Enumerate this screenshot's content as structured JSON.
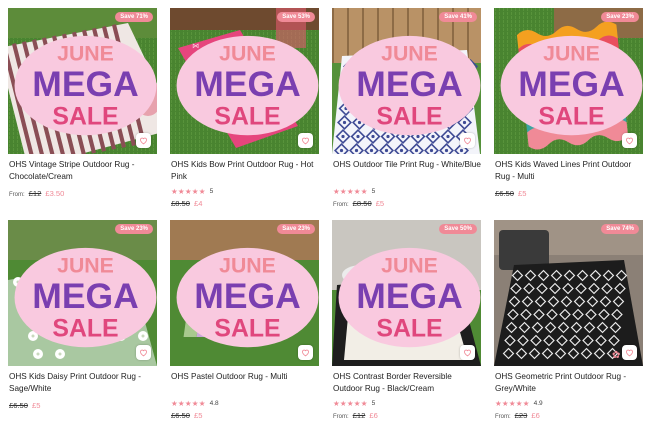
{
  "products": [
    {
      "title": "OHS Vintage Stripe Outdoor Rug - Chocolate/Cream",
      "badge": "Save 71%",
      "has_mega": true,
      "art": "stripe",
      "rating_stars": "",
      "rating_value": "",
      "from_label": "From:",
      "price_was": "£12",
      "price_now": "£3.50"
    },
    {
      "title": "OHS Kids Bow Print Outdoor Rug - Hot Pink",
      "badge": "Save 53%",
      "has_mega": true,
      "art": "bow",
      "rating_stars": "★★★★★",
      "rating_value": "5",
      "from_label": "",
      "price_was": "£8.50",
      "price_now": "£4"
    },
    {
      "title": "OHS Outdoor Tile Print Rug - White/Blue",
      "badge": "Save 41%",
      "has_mega": true,
      "art": "tile",
      "rating_stars": "★★★★★",
      "rating_value": "5",
      "from_label": "From:",
      "price_was": "£8.50",
      "price_now": "£5"
    },
    {
      "title": "OHS Kids Waved Lines Print Outdoor Rug - Multi",
      "badge": "Save 23%",
      "has_mega": true,
      "art": "wave",
      "rating_stars": "",
      "rating_value": "",
      "from_label": "",
      "price_was": "£6.50",
      "price_now": "£5"
    },
    {
      "title": "OHS Kids Daisy Print Outdoor Rug - Sage/White",
      "badge": "Save 23%",
      "has_mega": true,
      "art": "daisy",
      "rating_stars": "",
      "rating_value": "",
      "from_label": "",
      "price_was": "£6.50",
      "price_now": "£5"
    },
    {
      "title": "OHS Pastel Outdoor Rug - Multi",
      "badge": "Save 23%",
      "has_mega": true,
      "art": "pastel",
      "rating_stars": "★★★★★",
      "rating_value": "4.8",
      "from_label": "",
      "price_was": "£6.50",
      "price_now": "£5"
    },
    {
      "title": "OHS Contrast Border Reversible Outdoor Rug - Black/Cream",
      "badge": "Save 50%",
      "has_mega": true,
      "art": "border",
      "rating_stars": "★★★★★",
      "rating_value": "5",
      "from_label": "From:",
      "price_was": "£12",
      "price_now": "£6"
    },
    {
      "title": "OHS Geometric Print Outdoor Rug - Grey/White",
      "badge": "Save 74%",
      "has_mega": false,
      "art": "geo",
      "rating_stars": "★★★★★",
      "rating_value": "4.9",
      "from_label": "From:",
      "price_was": "£23",
      "price_now": "£6"
    }
  ],
  "promo_badge": {
    "line1": "JUNE",
    "line2": "MEGA",
    "line3": "SALE"
  },
  "colors": {
    "accent": "#f08a97",
    "grass": "#4f8a34",
    "text": "#222222"
  },
  "icons": {
    "wishlist": "heart-outline-icon"
  }
}
